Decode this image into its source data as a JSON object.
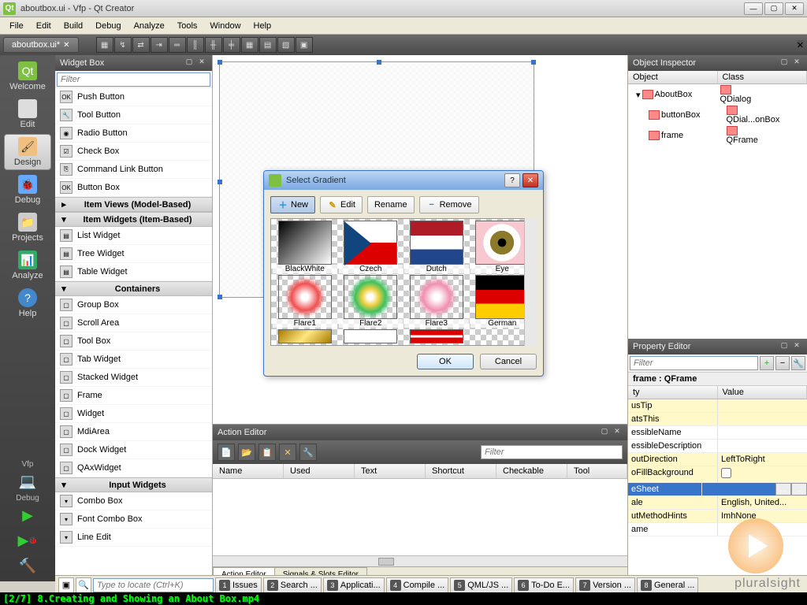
{
  "window": {
    "title": "aboutbox.ui - Vfp - Qt Creator"
  },
  "menus": [
    "File",
    "Edit",
    "Build",
    "Debug",
    "Analyze",
    "Tools",
    "Window",
    "Help"
  ],
  "tab": {
    "label": "aboutbox.ui*"
  },
  "rail": {
    "items": [
      {
        "label": "Welcome"
      },
      {
        "label": "Edit"
      },
      {
        "label": "Design"
      },
      {
        "label": "Debug"
      },
      {
        "label": "Projects"
      },
      {
        "label": "Analyze"
      },
      {
        "label": "Help"
      }
    ],
    "active": 2,
    "run_label": "Vfp",
    "debug_label": "Debug"
  },
  "widgetbox": {
    "title": "Widget Box",
    "filter_placeholder": "Filter",
    "buttons": [
      "Push Button",
      "Tool Button",
      "Radio Button",
      "Check Box",
      "Command Link Button",
      "Button Box"
    ],
    "cat_itemviews": "Item Views (Model-Based)",
    "cat_itemwidgets": "Item Widgets (Item-Based)",
    "itemwidgets": [
      "List Widget",
      "Tree Widget",
      "Table Widget"
    ],
    "cat_containers": "Containers",
    "containers": [
      "Group Box",
      "Scroll Area",
      "Tool Box",
      "Tab Widget",
      "Stacked Widget",
      "Frame",
      "Widget",
      "MdiArea",
      "Dock Widget",
      "QAxWidget"
    ],
    "cat_input": "Input Widgets",
    "inputs": [
      "Combo Box",
      "Font Combo Box",
      "Line Edit"
    ]
  },
  "object_inspector": {
    "title": "Object Inspector",
    "cols": [
      "Object",
      "Class"
    ],
    "rows": [
      {
        "obj": "AboutBox",
        "cls": "QDialog",
        "indent": 0
      },
      {
        "obj": "buttonBox",
        "cls": "QDial...onBox",
        "indent": 1
      },
      {
        "obj": "frame",
        "cls": "QFrame",
        "indent": 1
      }
    ]
  },
  "property_editor": {
    "title": "Property Editor",
    "filter_placeholder": "Filter",
    "context": "frame : QFrame",
    "cols": [
      "ty",
      "Value"
    ],
    "rows": [
      {
        "p": "usTip",
        "v": "",
        "y": true
      },
      {
        "p": "atsThis",
        "v": "",
        "y": true
      },
      {
        "p": "essibleName",
        "v": "",
        "y": false
      },
      {
        "p": "essibleDescription",
        "v": "",
        "y": false
      },
      {
        "p": "outDirection",
        "v": "LeftToRight",
        "y": true
      },
      {
        "p": "oFillBackground",
        "v": "",
        "y": true,
        "check": true
      },
      {
        "p": "eSheet",
        "v": "",
        "sel": true,
        "dots": true
      },
      {
        "p": "ale",
        "v": "English, United...",
        "y": true
      },
      {
        "p": "utMethodHints",
        "v": "ImhNone",
        "y": true
      },
      {
        "p": "ame",
        "v": "",
        "y": false
      }
    ]
  },
  "action_editor": {
    "title": "Action Editor",
    "filter_placeholder": "Filter",
    "cols": [
      "Name",
      "Used",
      "Text",
      "Shortcut",
      "Checkable",
      "Tool"
    ],
    "tabs": [
      "Action Editor",
      "Signals & Slots Editor"
    ]
  },
  "dialog": {
    "title": "Select Gradient",
    "buttons": {
      "new": "New",
      "edit": "Edit",
      "rename": "Rename",
      "remove": "Remove"
    },
    "ok": "OK",
    "cancel": "Cancel",
    "swatches": [
      {
        "name": "BlackWhite",
        "cls": "sw-bw"
      },
      {
        "name": "Czech",
        "cls": "sw-czech"
      },
      {
        "name": "Dutch",
        "cls": "sw-dutch"
      },
      {
        "name": "Eye",
        "cls": "sw-eye"
      },
      {
        "name": "Flare1",
        "cls": "sw-flare1"
      },
      {
        "name": "Flare2",
        "cls": "sw-flare2"
      },
      {
        "name": "Flare3",
        "cls": "sw-flare3"
      },
      {
        "name": "German",
        "cls": "sw-german"
      }
    ],
    "partial": [
      "sw-gold",
      "sw-white",
      "sw-red"
    ]
  },
  "locator": {
    "placeholder": "Type to locate (Ctrl+K)"
  },
  "status_tabs": [
    {
      "n": "1",
      "t": "Issues"
    },
    {
      "n": "2",
      "t": "Search ..."
    },
    {
      "n": "3",
      "t": "Applicati..."
    },
    {
      "n": "4",
      "t": "Compile ..."
    },
    {
      "n": "5",
      "t": "QML/JS ..."
    },
    {
      "n": "6",
      "t": "To-Do E..."
    },
    {
      "n": "7",
      "t": "Version ..."
    },
    {
      "n": "8",
      "t": "General ..."
    }
  ],
  "caption": "[2/7] 8.Creating and Showing an About Box.mp4",
  "brand": "pluralsight"
}
